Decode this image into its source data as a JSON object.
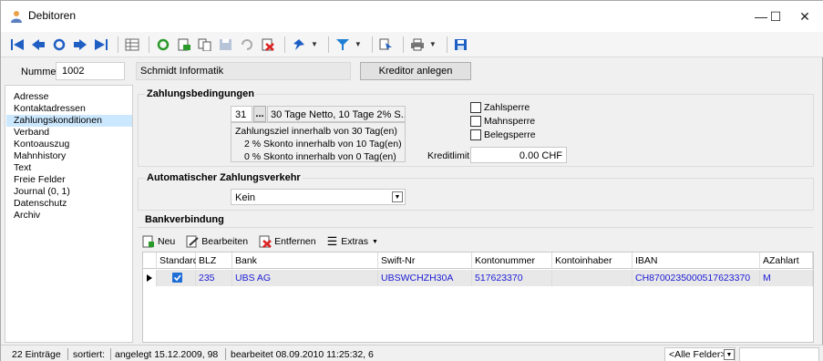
{
  "window": {
    "title": "Debitoren",
    "minimize": "—",
    "maximize": "☐",
    "close": "✕"
  },
  "toolbar": {
    "icons": [
      "first-record-icon",
      "previous-record-icon",
      "refresh-icon",
      "next-record-icon",
      "last-record-icon",
      "table-view-icon",
      "reload-icon",
      "export-icon",
      "copy-icon",
      "save-icon",
      "undo-icon",
      "delete-icon",
      "pin-icon",
      "filter-icon",
      "cursor-icon",
      "print-icon",
      "floppy-icon"
    ]
  },
  "header": {
    "number_label": "Nummer",
    "number_value": "1002",
    "name_value": "Schmidt Informatik",
    "kreditor_button": "Kreditor anlegen"
  },
  "sidebar": {
    "items": [
      {
        "label": "Adresse"
      },
      {
        "label": "Kontaktadressen"
      },
      {
        "label": "Zahlungskonditionen",
        "selected": true
      },
      {
        "label": "Verband"
      },
      {
        "label": "Kontoauszug"
      },
      {
        "label": "Mahnhistory"
      },
      {
        "label": "Text"
      },
      {
        "label": "Freie Felder"
      },
      {
        "label": "Journal (0, 1)"
      },
      {
        "label": "Datenschutz"
      },
      {
        "label": "Archiv"
      }
    ]
  },
  "zahlungsbedingungen": {
    "title": "Zahlungsbedingungen",
    "code": "31",
    "ellipsis": "...",
    "description": "30 Tage Netto, 10 Tage 2% S...",
    "line1": "Zahlungsziel innerhalb von 30 Tag(en)",
    "line2": "2 % Skonto innerhalb von 10 Tag(en)",
    "line3": "0  % Skonto innerhalb von 0 Tag(en)",
    "zahlsperre": "Zahlsperre",
    "mahnsperre": "Mahnsperre",
    "belegsperre": "Belegsperre",
    "kreditlimit_label": "Kreditlimit",
    "kreditlimit_value": "0.00 CHF"
  },
  "zahlungsverkehr": {
    "title": "Automatischer Zahlungsverkehr",
    "selected": "Kein"
  },
  "bankverbindung": {
    "title": "Bankverbindung",
    "toolbar": {
      "neu": "Neu",
      "bearbeiten": "Bearbeiten",
      "entfernen": "Entfernen",
      "extras": "Extras"
    },
    "columns": [
      "Standard",
      "BLZ",
      "Bank",
      "Swift-Nr",
      "Kontonummer",
      "Kontoinhaber",
      "IBAN",
      "AZahlart"
    ],
    "rows": [
      {
        "standard": true,
        "blz": "235",
        "bank": "UBS AG",
        "swift": "UBSWCHZH30A",
        "konto": "517623370",
        "inhaber": "",
        "iban": "CH8700235000517623370",
        "azahlart": "M"
      }
    ]
  },
  "status": {
    "entries": "22 Einträge",
    "sorted": "sortiert:",
    "created": "angelegt 15.12.2009, 98",
    "edited": "bearbeitet 08.09.2010 11:25:32, 6",
    "filter": "<Alle Felder>"
  }
}
